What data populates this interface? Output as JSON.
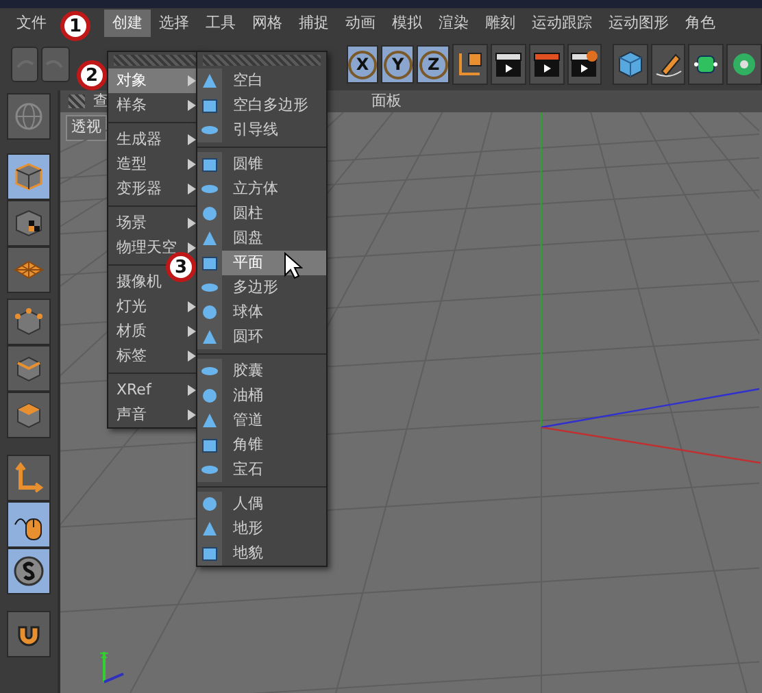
{
  "menubar": [
    {
      "label": "文件",
      "selected": false
    },
    {
      "label": "创建",
      "selected": true
    },
    {
      "label": "选择",
      "selected": false
    },
    {
      "label": "工具",
      "selected": false
    },
    {
      "label": "网格",
      "selected": false
    },
    {
      "label": "捕捉",
      "selected": false
    },
    {
      "label": "动画",
      "selected": false
    },
    {
      "label": "模拟",
      "selected": false
    },
    {
      "label": "渲染",
      "selected": false
    },
    {
      "label": "雕刻",
      "selected": false
    },
    {
      "label": "运动跟踪",
      "selected": false
    },
    {
      "label": "运动图形",
      "selected": false
    },
    {
      "label": "角色",
      "selected": false
    }
  ],
  "toolbar": {
    "axis_buttons": [
      "X",
      "Y",
      "Z"
    ]
  },
  "left_toolbar": [
    {
      "kind": "globe",
      "selected": false
    },
    {
      "kind": "cube",
      "selected": true
    },
    {
      "kind": "checker",
      "selected": false
    },
    {
      "kind": "grid",
      "selected": false
    },
    {
      "kind": "points",
      "selected": false
    },
    {
      "kind": "edges",
      "selected": false
    },
    {
      "kind": "polygons",
      "selected": false
    },
    {
      "kind": "axis",
      "selected": false
    },
    {
      "kind": "mouse",
      "selected": true
    },
    {
      "kind": "snap",
      "selected": true
    },
    {
      "kind": "magnet",
      "selected": false
    }
  ],
  "viewport": {
    "menu": [
      "查",
      "面板"
    ],
    "view_label": "透视"
  },
  "create_menu": {
    "groups": [
      [
        {
          "label": "对象",
          "selected": true,
          "arrow": true
        },
        {
          "label": "样条",
          "selected": false,
          "arrow": true
        }
      ],
      [
        {
          "label": "生成器",
          "selected": false,
          "arrow": true
        },
        {
          "label": "造型",
          "selected": false,
          "arrow": true
        },
        {
          "label": "变形器",
          "selected": false,
          "arrow": true
        }
      ],
      [
        {
          "label": "场景",
          "selected": false,
          "arrow": true
        },
        {
          "label": "物理天空",
          "selected": false,
          "arrow": true
        }
      ],
      [
        {
          "label": "摄像机",
          "selected": false,
          "arrow": false
        },
        {
          "label": "灯光",
          "selected": false,
          "arrow": true
        },
        {
          "label": "材质",
          "selected": false,
          "arrow": true
        },
        {
          "label": "标签",
          "selected": false,
          "arrow": true
        }
      ],
      [
        {
          "label": "XRef",
          "selected": false,
          "arrow": true
        },
        {
          "label": "声音",
          "selected": false,
          "arrow": true
        }
      ]
    ]
  },
  "object_menu": {
    "groups": [
      [
        {
          "label": "空白",
          "selected": false
        },
        {
          "label": "空白多边形",
          "selected": false
        },
        {
          "label": "引导线",
          "selected": false
        }
      ],
      [
        {
          "label": "圆锥",
          "selected": false
        },
        {
          "label": "立方体",
          "selected": false
        },
        {
          "label": "圆柱",
          "selected": false
        },
        {
          "label": "圆盘",
          "selected": false
        },
        {
          "label": "平面",
          "selected": true
        },
        {
          "label": "多边形",
          "selected": false
        },
        {
          "label": "球体",
          "selected": false
        },
        {
          "label": "圆环",
          "selected": false
        }
      ],
      [
        {
          "label": "胶囊",
          "selected": false
        },
        {
          "label": "油桶",
          "selected": false
        },
        {
          "label": "管道",
          "selected": false
        },
        {
          "label": "角锥",
          "selected": false
        },
        {
          "label": "宝石",
          "selected": false
        }
      ],
      [
        {
          "label": "人偶",
          "selected": false
        },
        {
          "label": "地形",
          "selected": false
        },
        {
          "label": "地貌",
          "selected": false
        }
      ]
    ]
  },
  "annotations": [
    "1",
    "2",
    "3"
  ]
}
